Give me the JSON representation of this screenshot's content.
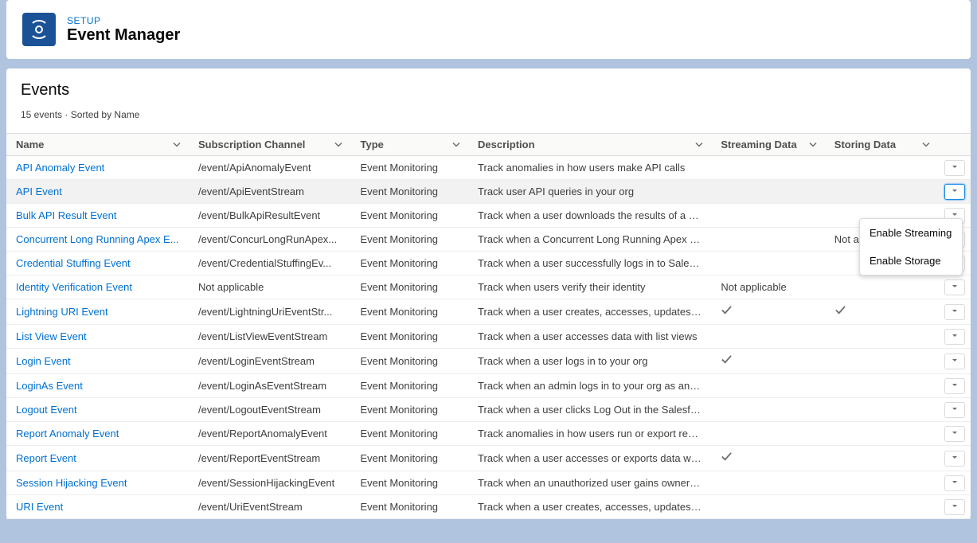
{
  "header": {
    "eyebrow": "SETUP",
    "title": "Event Manager"
  },
  "section": {
    "title": "Events",
    "count_text": "15 events",
    "sort_text": "Sorted by Name"
  },
  "columns": {
    "name": "Name",
    "subscription": "Subscription Channel",
    "type": "Type",
    "description": "Description",
    "streaming": "Streaming Data",
    "storing": "Storing Data"
  },
  "dropdown": {
    "enable_streaming": "Enable Streaming",
    "enable_storage": "Enable Storage"
  },
  "rows": [
    {
      "name": "API Anomaly Event",
      "sub": "/event/ApiAnomalyEvent",
      "type": "Event Monitoring",
      "desc": "Track anomalies in how users make API calls",
      "stream": "",
      "store": "",
      "highlighted": false,
      "dropdown_open": false
    },
    {
      "name": "API Event",
      "sub": "/event/ApiEventStream",
      "type": "Event Monitoring",
      "desc": "Track user API queries in your org",
      "stream": "",
      "store": "",
      "highlighted": true,
      "dropdown_open": true
    },
    {
      "name": "Bulk API Result Event",
      "sub": "/event/BulkApiResultEvent",
      "type": "Event Monitoring",
      "desc": "Track when a user downloads the results of a B...",
      "stream": "",
      "store": "",
      "highlighted": false,
      "dropdown_open": false
    },
    {
      "name": "Concurrent Long Running Apex E...",
      "sub": "/event/ConcurLongRunApex...",
      "type": "Event Monitoring",
      "desc": "Track when a Concurrent Long Running Apex e...",
      "stream": "",
      "store": "Not applicable",
      "highlighted": false,
      "dropdown_open": false
    },
    {
      "name": "Credential Stuffing Event",
      "sub": "/event/CredentialStuffingEv...",
      "type": "Event Monitoring",
      "desc": "Track when a user successfully logs in to Salesf...",
      "stream": "",
      "store": "",
      "highlighted": false,
      "dropdown_open": false
    },
    {
      "name": "Identity Verification Event",
      "sub": "Not applicable",
      "type": "Event Monitoring",
      "desc": "Track when users verify their identity",
      "stream": "Not applicable",
      "store": "",
      "highlighted": false,
      "dropdown_open": false
    },
    {
      "name": "Lightning URI Event",
      "sub": "/event/LightningUriEventStr...",
      "type": "Event Monitoring",
      "desc": "Track when a user creates, accesses, updates, o...",
      "stream": "check",
      "store": "check",
      "highlighted": false,
      "dropdown_open": false
    },
    {
      "name": "List View Event",
      "sub": "/event/ListViewEventStream",
      "type": "Event Monitoring",
      "desc": "Track when a user accesses data with list views",
      "stream": "",
      "store": "",
      "highlighted": false,
      "dropdown_open": false
    },
    {
      "name": "Login Event",
      "sub": "/event/LoginEventStream",
      "type": "Event Monitoring",
      "desc": "Track when a user logs in to your org",
      "stream": "check",
      "store": "",
      "highlighted": false,
      "dropdown_open": false
    },
    {
      "name": "LoginAs Event",
      "sub": "/event/LoginAsEventStream",
      "type": "Event Monitoring",
      "desc": "Track when an admin logs in to your org as ano...",
      "stream": "",
      "store": "",
      "highlighted": false,
      "dropdown_open": false
    },
    {
      "name": "Logout Event",
      "sub": "/event/LogoutEventStream",
      "type": "Event Monitoring",
      "desc": "Track when a user clicks Log Out in the Salesfo...",
      "stream": "",
      "store": "",
      "highlighted": false,
      "dropdown_open": false
    },
    {
      "name": "Report Anomaly Event",
      "sub": "/event/ReportAnomalyEvent",
      "type": "Event Monitoring",
      "desc": "Track anomalies in how users run or export rep...",
      "stream": "",
      "store": "",
      "highlighted": false,
      "dropdown_open": false
    },
    {
      "name": "Report Event",
      "sub": "/event/ReportEventStream",
      "type": "Event Monitoring",
      "desc": "Track when a user accesses or exports data wit...",
      "stream": "check",
      "store": "",
      "highlighted": false,
      "dropdown_open": false
    },
    {
      "name": "Session Hijacking Event",
      "sub": "/event/SessionHijackingEvent",
      "type": "Event Monitoring",
      "desc": "Track when an unauthorized user gains owners...",
      "stream": "",
      "store": "",
      "highlighted": false,
      "dropdown_open": false
    },
    {
      "name": "URI Event",
      "sub": "/event/UriEventStream",
      "type": "Event Monitoring",
      "desc": "Track when a user creates, accesses, updates, o...",
      "stream": "",
      "store": "",
      "highlighted": false,
      "dropdown_open": false
    }
  ]
}
